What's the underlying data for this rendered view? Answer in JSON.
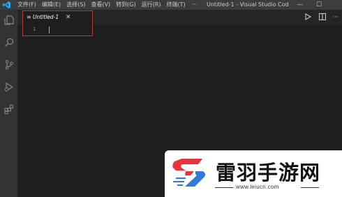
{
  "menu": [
    "文件(F)",
    "编辑(E)",
    "选择(S)",
    "查看(V)",
    "转到(G)",
    "运行(R)",
    "终端(T)"
  ],
  "more": "···",
  "window_title": "Untitled-1 - Visual Studio Code [...",
  "window_controls": {
    "minimize": "—",
    "maximize": "☐"
  },
  "tab": {
    "icon": "≡",
    "label": "Untitled-1",
    "close": "✕"
  },
  "editor": {
    "line_number": "1"
  },
  "watermark": {
    "name": "雷羽手游网",
    "url": "www.leiucn.com"
  },
  "colors": {
    "accent": "#007acc",
    "highlight_box": "#c0393b",
    "brand": "#e8323c",
    "brand_blue": "#2f7bd9"
  }
}
